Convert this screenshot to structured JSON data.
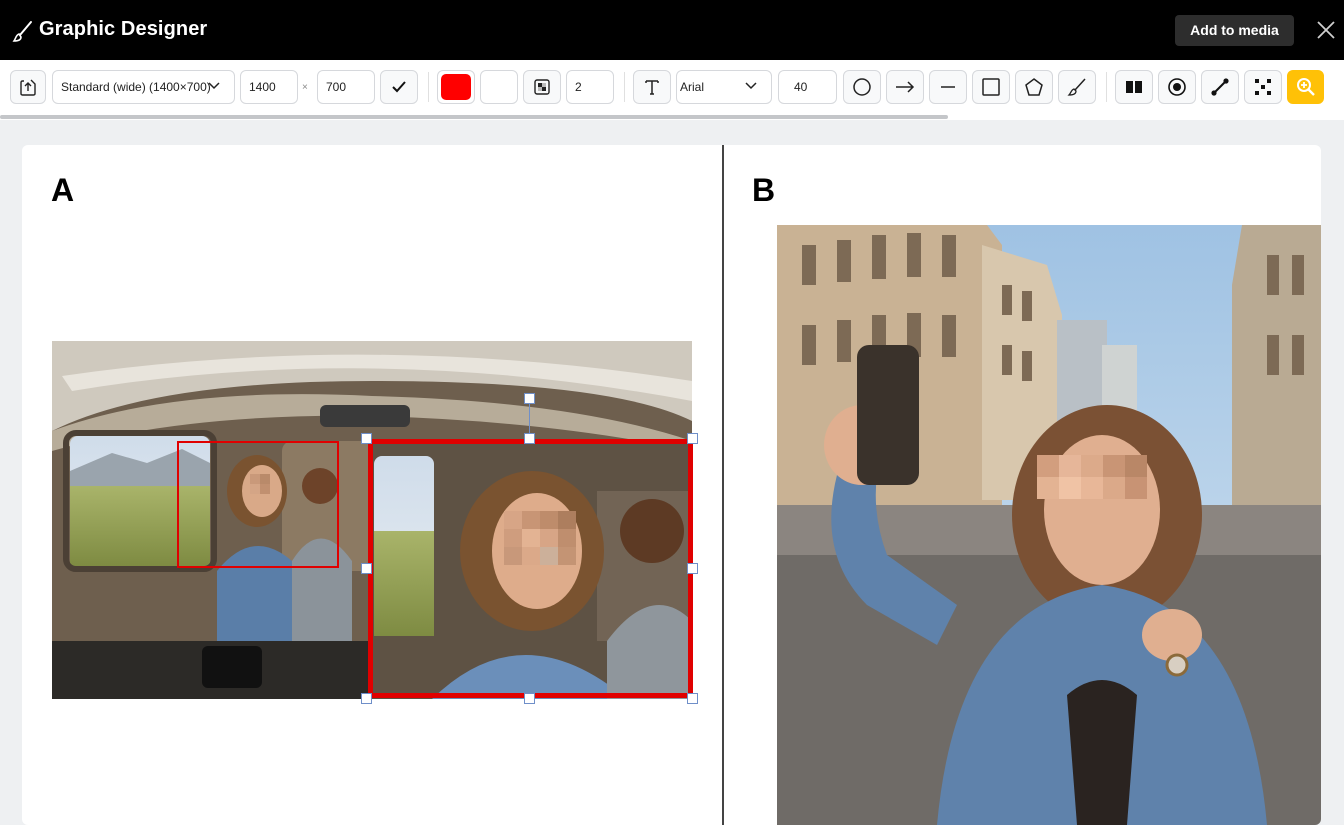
{
  "app": {
    "title": "Graphic Designer",
    "add_to_media_label": "Add to media"
  },
  "toolbar": {
    "size_preset": "Standard (wide) (1400×700)",
    "width_value": "1400",
    "times_symbol": "×",
    "height_value": "700",
    "stroke_color": "#ff0000",
    "fill_color": "#ffffff",
    "stroke_width": "2",
    "font_name": "Arial",
    "font_size": "40",
    "active_tool_color": "#ffc107"
  },
  "canvas": {
    "panel_a_label": "A",
    "panel_b_label": "B"
  },
  "colors": {
    "title_bar": "#000000",
    "selection": "#e00000",
    "handle_border": "#6f8fc9"
  }
}
